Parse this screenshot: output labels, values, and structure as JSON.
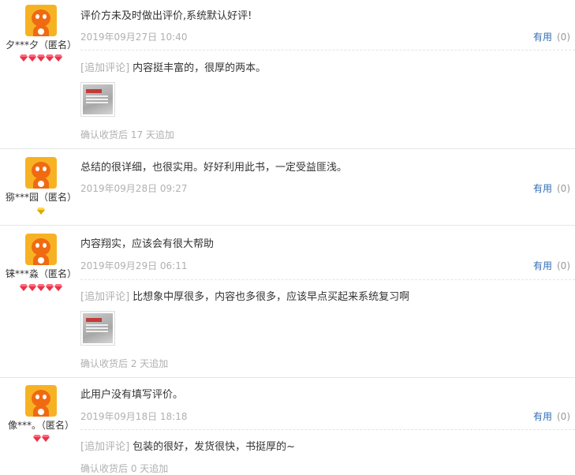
{
  "useful_label": "有用",
  "useful_count": "(0)",
  "extra_tag": "[追加评论]",
  "reviews": [
    {
      "username": "夕***夕（匿名）",
      "text": "评价方未及时做出评价,系统默认好评!",
      "date": "2019年09月27日 10:40",
      "extra_text": "内容挺丰富的，很厚的两本。",
      "after": "确认收货后 17 天追加",
      "gems": 5,
      "gem_color": "red"
    },
    {
      "username": "猕***园（匿名）",
      "text": "总结的很详细，也很实用。好好利用此书，一定受益匪浅。",
      "date": "2019年09月28日 09:27",
      "gems": 1,
      "gem_color": "yellow"
    },
    {
      "username": "铼***淼（匿名）",
      "text": "内容翔实，应该会有很大帮助",
      "date": "2019年09月29日 06:11",
      "extra_text": "比想象中厚很多，内容也多很多，应该早点买起来系统复习啊",
      "after": "确认收货后 2 天追加",
      "gems": 5,
      "gem_color": "red"
    },
    {
      "username": "像***。（匿名）",
      "text": "此用户没有填写评价。",
      "date": "2019年09月18日 18:18",
      "extra_text": "包装的很好，发货很快，书挺厚的~",
      "after": "确认收货后 0 天追加",
      "gems": 2,
      "gem_color": "red"
    }
  ]
}
